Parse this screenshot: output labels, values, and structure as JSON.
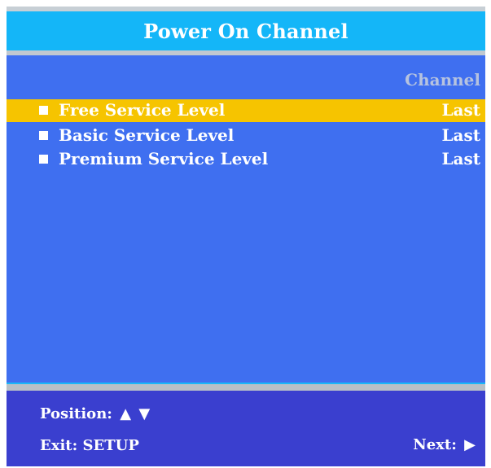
{
  "window": {
    "title": "Power On Channel"
  },
  "list": {
    "column_header": "Channel",
    "items": [
      {
        "label": "Free Service Level",
        "value": "Last",
        "selected": true
      },
      {
        "label": "Basic Service Level",
        "value": "Last",
        "selected": false
      },
      {
        "label": "Premium Service Level",
        "value": "Last",
        "selected": false
      }
    ]
  },
  "footer": {
    "position_label": "Position:",
    "position_icons": {
      "up": "▲",
      "down": "▼"
    },
    "exit_label": "Exit:",
    "exit_value": "SETUP",
    "next_label": "Next:",
    "next_icon": "▶"
  },
  "colors": {
    "title_bar": "#14b6f8",
    "content_background": "#3f6ff0",
    "selected_row": "#f6c400",
    "footer_background": "#3a3fcf",
    "header_text": "#b6c3df"
  },
  "icons": {
    "bullet": "square-bullet-icon",
    "up": "up-arrow-icon",
    "down": "down-arrow-icon",
    "next": "right-arrow-icon"
  }
}
